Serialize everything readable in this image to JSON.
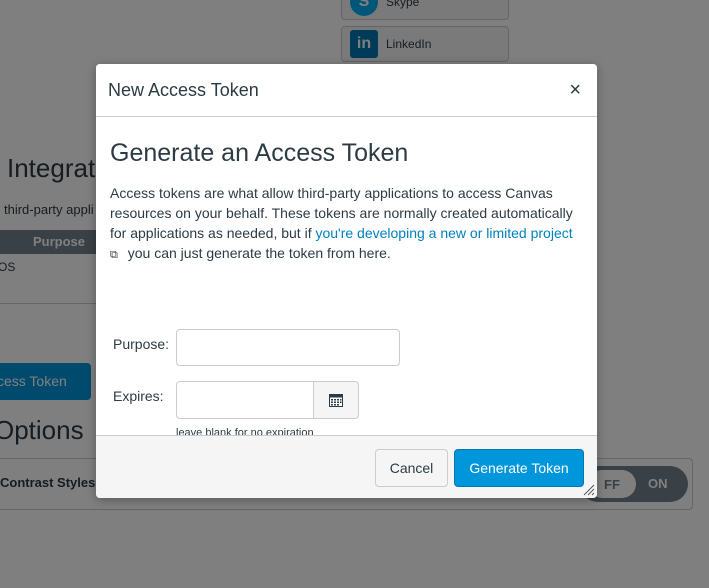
{
  "background": {
    "services": [
      {
        "label": "Skype",
        "icon": "skype-icon"
      },
      {
        "label": "LinkedIn",
        "icon": "linkedin-icon",
        "glyph": "in"
      }
    ],
    "heading": "l Integratio",
    "subtext": "third-party appli",
    "table_header": "Purpose",
    "cells": [
      "OS",
      "l"
    ],
    "new_token_button": "ccess Token",
    "options_heading": "Options",
    "contrast_label": "Contrast Styles",
    "toggle_off": "FF",
    "toggle_on": "ON"
  },
  "modal": {
    "title": "New Access Token",
    "close_glyph": "×",
    "heading": "Generate an Access Token",
    "description_before": "Access tokens are what allow third-party applications to access Canvas resources on your behalf. These tokens are normally created automatically for applications as needed, but if ",
    "description_link": "you're developing a new or limited project",
    "description_after": " you can just generate the token from here.",
    "purpose_label": "Purpose:",
    "purpose_value": "",
    "expires_label": "Expires:",
    "expires_value": "",
    "expires_hint": "leave blank for no expiration",
    "cancel_label": "Cancel",
    "generate_label": "Generate Token"
  },
  "colors": {
    "primary": "#0096db",
    "link": "#0081bd",
    "text": "#2d3b45"
  }
}
